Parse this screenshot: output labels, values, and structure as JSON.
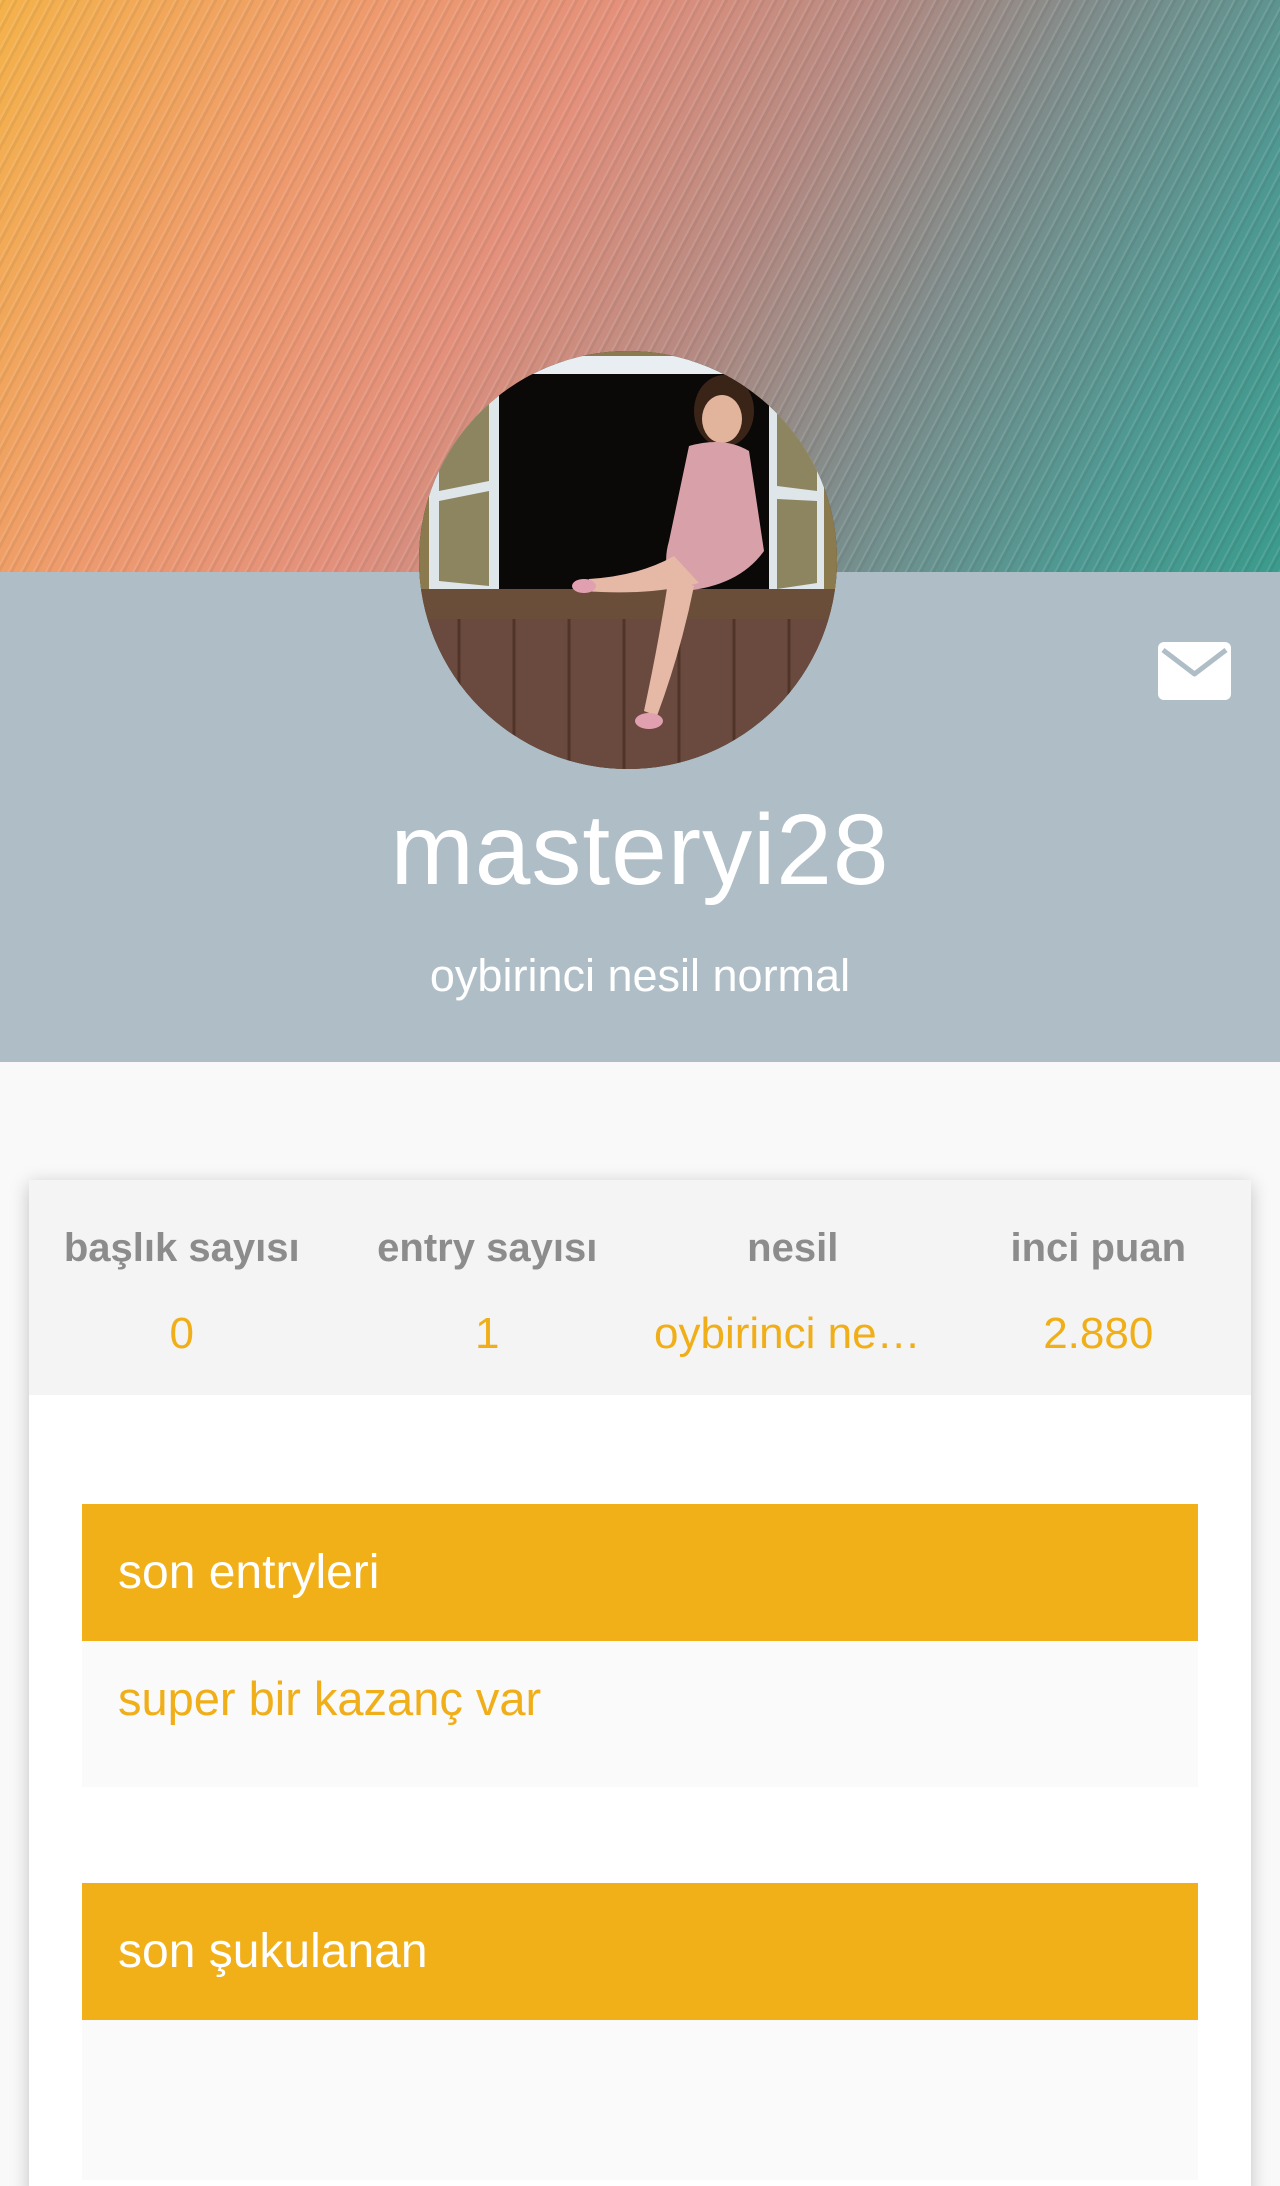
{
  "profile": {
    "username": "masteryi28",
    "generation": "oybirinci nesil normal",
    "avatar": "avatar-photo",
    "message_icon": "mail-icon"
  },
  "stats": [
    {
      "label": "başlık sayısı",
      "value": "0"
    },
    {
      "label": "entry sayısı",
      "value": "1"
    },
    {
      "label": "nesil",
      "value": "oybirinci nesil normal"
    },
    {
      "label": "inci puan",
      "value": "2.880"
    }
  ],
  "sections": {
    "recent_entries": {
      "title": "son entryleri",
      "items": [
        "super bir kazanç var"
      ]
    },
    "recent_liked": {
      "title": "son şukulanan",
      "items": []
    }
  },
  "colors": {
    "accent": "#f1af18",
    "header_band": "#afbec6",
    "stat_label": "#8c8c8c"
  }
}
